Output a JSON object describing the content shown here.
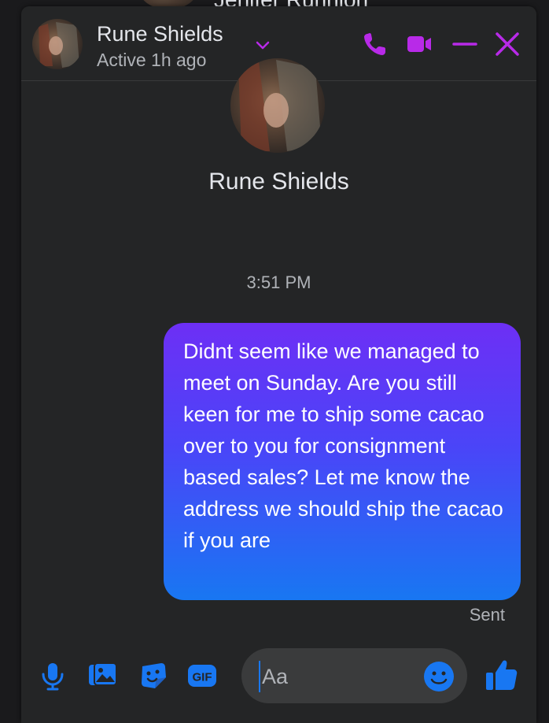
{
  "background_chat": {
    "partial_name": "Jenifer Runnion"
  },
  "header": {
    "name": "Rune Shields",
    "status": "Active 1h ago",
    "accent_color": "#b82ae8"
  },
  "profile": {
    "name": "Rune Shields"
  },
  "conversation": {
    "timestamp": "3:51 PM",
    "messages": [
      {
        "from": "me",
        "text": "Didnt seem like we managed to meet on Sunday. Are you still keen for me to ship some cacao over to you for consignment based sales? Let me know the address we should ship the cacao if you are"
      }
    ],
    "status": "Sent"
  },
  "composer": {
    "placeholder": "Aa",
    "value": "",
    "icons": [
      "microphone-icon",
      "image-icon",
      "sticker-icon",
      "gif-icon",
      "emoji-icon",
      "thumbs-up-icon"
    ],
    "gif_label": "GIF",
    "accent_color": "#1877f2"
  }
}
